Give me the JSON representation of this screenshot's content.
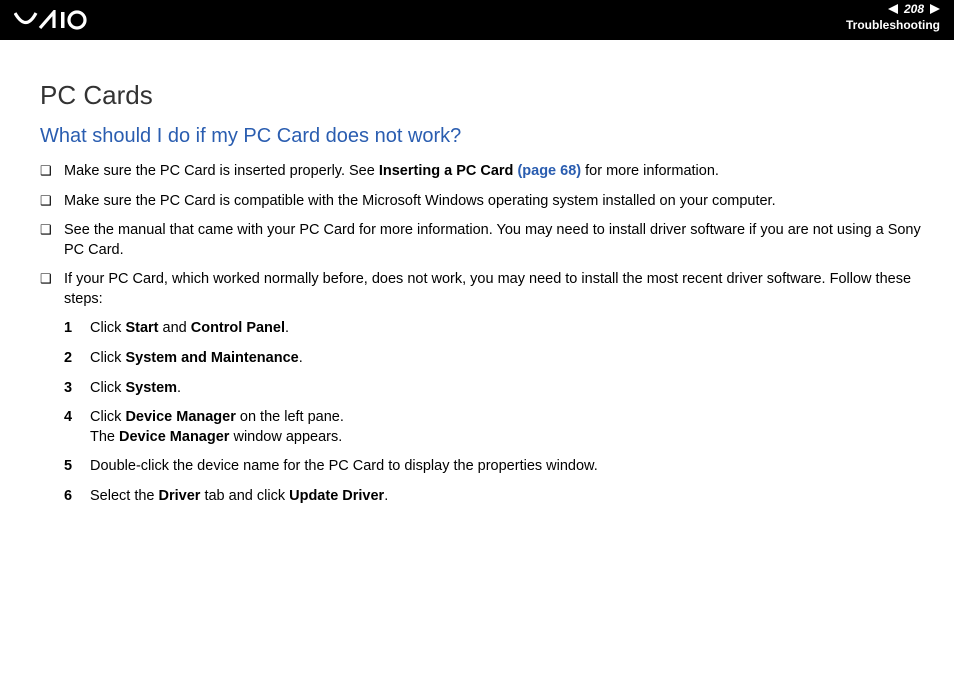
{
  "header": {
    "page_number": "208",
    "section": "Troubleshooting"
  },
  "title": "PC Cards",
  "question": "What should I do if my PC Card does not work?",
  "bullets": [
    {
      "pre": "Make sure the PC Card is inserted properly. See ",
      "bold1": "Inserting a PC Card",
      "link": " (page 68)",
      "post": " for more information."
    },
    {
      "text": "Make sure the PC Card is compatible with the Microsoft Windows operating system installed on your computer."
    },
    {
      "text": "See the manual that came with your PC Card for more information. You may need to install driver software if you are not using a Sony PC Card."
    },
    {
      "text": "If your PC Card, which worked normally before, does not work, you may need to install the most recent driver software. Follow these steps:"
    }
  ],
  "steps": [
    {
      "n": "1",
      "pre": "Click ",
      "b1": "Start",
      "mid": " and ",
      "b2": "Control Panel",
      "post": "."
    },
    {
      "n": "2",
      "pre": "Click ",
      "b1": "System and Maintenance",
      "post": "."
    },
    {
      "n": "3",
      "pre": "Click ",
      "b1": "System",
      "post": "."
    },
    {
      "n": "4",
      "pre": "Click ",
      "b1": "Device Manager",
      "mid": " on the left pane.",
      "line2_pre": "The ",
      "line2_b": "Device Manager",
      "line2_post": " window appears."
    },
    {
      "n": "5",
      "text": "Double-click the device name for the PC Card to display the properties window."
    },
    {
      "n": "6",
      "pre": "Select the ",
      "b1": "Driver",
      "mid": " tab and click ",
      "b2": "Update Driver",
      "post": "."
    }
  ]
}
